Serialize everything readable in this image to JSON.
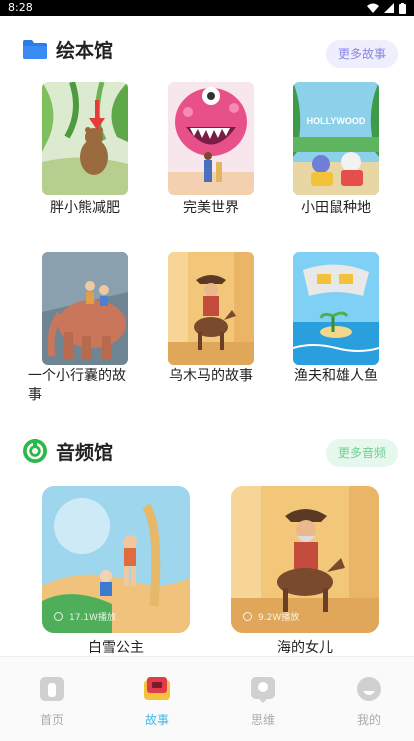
{
  "status_bar": {
    "time": "8:28"
  },
  "picture_books": {
    "title": "绘本馆",
    "more_label": "更多故事",
    "books": [
      {
        "title": "胖小熊减肥"
      },
      {
        "title": "完美世界"
      },
      {
        "title": "小田鼠种地"
      },
      {
        "title": "一个小行囊的故事"
      },
      {
        "title": "乌木马的故事"
      },
      {
        "title": "渔夫和雄人鱼"
      }
    ],
    "cover_text": {
      "hollywood": "HOLLYWOOD"
    }
  },
  "audio": {
    "title": "音频馆",
    "more_label": "更多音频",
    "items": [
      {
        "title": "白雪公主",
        "caption": "17.1W播放"
      },
      {
        "title": "海的女儿",
        "caption": "9.2W播放"
      }
    ]
  },
  "tabs": [
    {
      "label": "首页",
      "active": false
    },
    {
      "label": "故事",
      "active": true
    },
    {
      "label": "思维",
      "active": false
    },
    {
      "label": "我的",
      "active": false
    }
  ],
  "colors": {
    "accent": "#48b8e2",
    "more_purple_bg": "#eeeefc",
    "more_green_bg": "#e6f7ed",
    "tab_inactive": "#aaaaaa"
  }
}
